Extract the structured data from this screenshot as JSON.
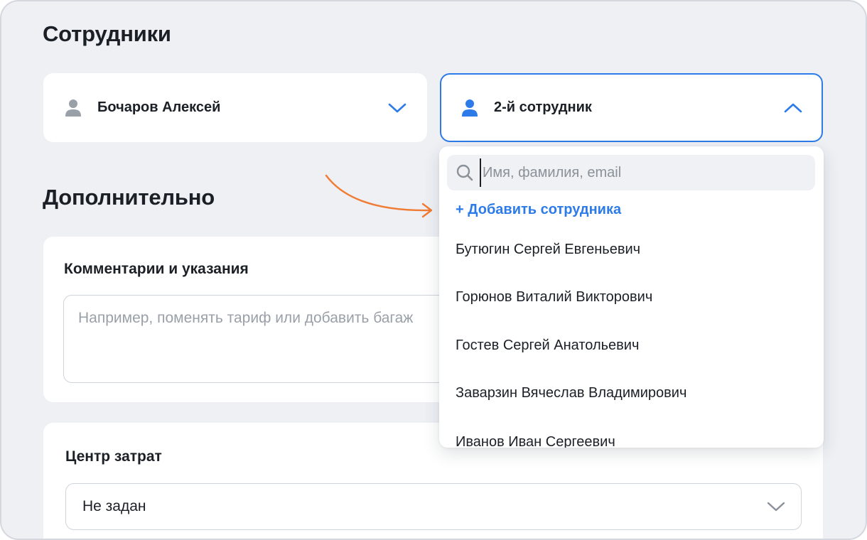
{
  "employees": {
    "title": "Сотрудники",
    "select_1": {
      "label": "Бочаров Алексей"
    },
    "select_2": {
      "label": "2-й сотрудник"
    }
  },
  "dropdown": {
    "search_placeholder": "Имя, фамилия, email",
    "add_label": "+ Добавить сотрудника",
    "options": [
      "Бутюгин Сергей Евгеньевич",
      "Горюнов Виталий Викторович",
      "Гостев Сергей Анатольевич",
      "Заварзин Вячеслав Владимирович",
      "Иванов Иван Сергеевич"
    ]
  },
  "extra": {
    "title": "Дополнительно",
    "comments_label": "Комментарии и указания",
    "comments_placeholder": "Например, поменять тариф или добавить багаж",
    "cost_label": "Центр затрат",
    "cost_value": "Не задан"
  },
  "colors": {
    "accent": "#2d7be8",
    "arrow": "#f07b34",
    "background": "#eef0f4",
    "icon_inactive": "#9aa0a8"
  },
  "icons": {
    "person": "person-icon",
    "chevron_down": "chevron-down-icon",
    "chevron_up": "chevron-up-icon",
    "search": "search-icon",
    "arrow": "arrow-annotation-icon"
  }
}
